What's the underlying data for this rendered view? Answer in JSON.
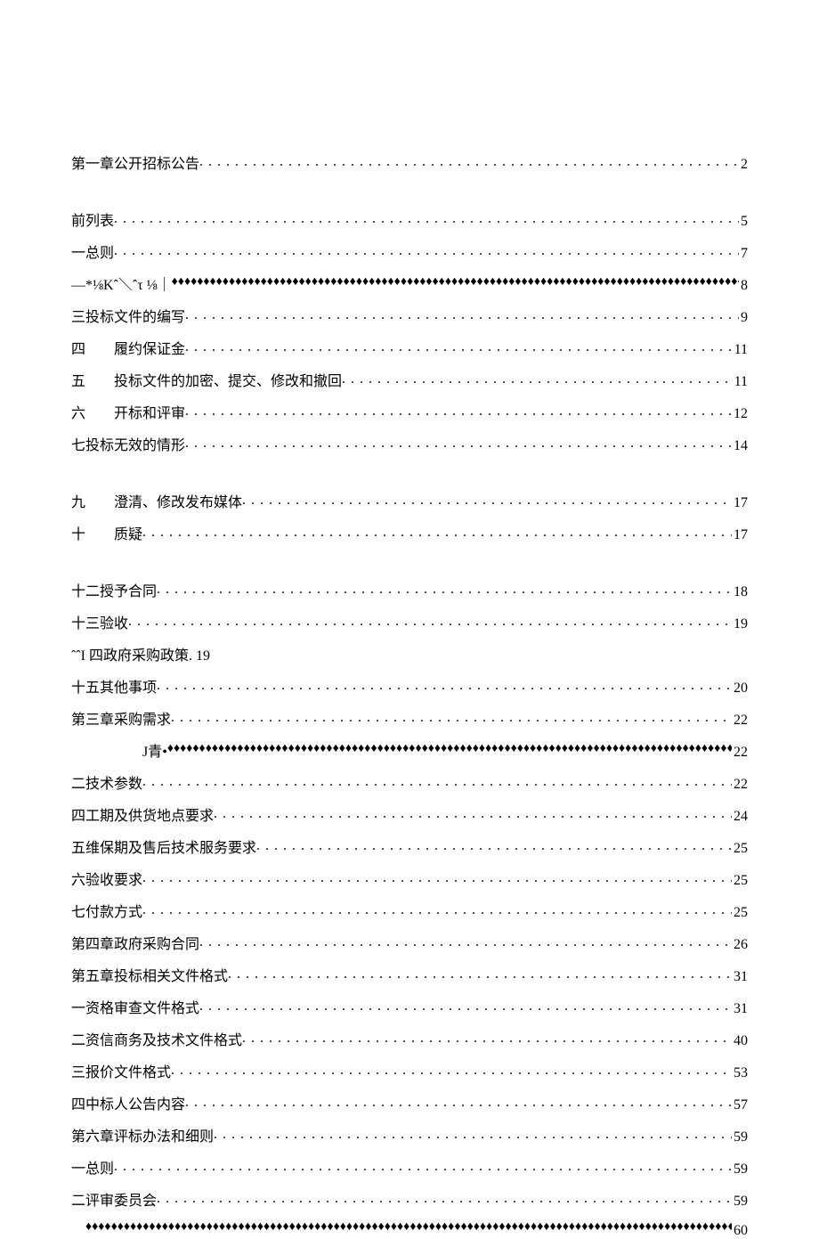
{
  "toc": [
    {
      "label": "第一章公开招标公告",
      "page": "2",
      "leader": "dots",
      "gapAfter": true
    },
    {
      "label": "前列表",
      "page": "5",
      "leader": "dots"
    },
    {
      "label": "一总则",
      "page": "7",
      "leader": "dots"
    },
    {
      "label": "—*⅛Kˆ＼ˆτ ⅛｜",
      "page": "8",
      "leader": "diamonds"
    },
    {
      "label": "三投标文件的编写",
      "page": "9",
      "leader": "dots"
    },
    {
      "label": "履约保证金 ",
      "prefix": "四",
      "page": "11",
      "leader": "dots"
    },
    {
      "label": "投标文件的加密、提交、修改和撤回 ",
      "prefix": "五",
      "page": "11",
      "leader": "dots"
    },
    {
      "label": "开标和评审 ",
      "prefix": "六",
      "page": "12",
      "leader": "dots"
    },
    {
      "label": "七投标无效的情形",
      "page": "14",
      "leader": "dots",
      "gapAfter": true
    },
    {
      "label": "澄清、修改发布媒体 ",
      "prefix": "九",
      "page": "17",
      "leader": "dots"
    },
    {
      "label": "质疑 ",
      "prefix": "十",
      "page": "17",
      "leader": "dots",
      "gapAfter": true
    },
    {
      "label": "十二授予合同",
      "page": "18",
      "leader": "dots"
    },
    {
      "label": "十三验收",
      "page": "19",
      "leader": "dots"
    },
    {
      "label": "ˆˆI 四政府采购政策. 19",
      "leader": "none"
    },
    {
      "label": "十五其他事项",
      "page": "20",
      "leader": "dots"
    },
    {
      "label": "第三章采购需求",
      "page": "22",
      "leader": "dots"
    },
    {
      "label": "J青•",
      "page": "22",
      "leader": "diamonds",
      "indentClass": "indent-jqing"
    },
    {
      "label": "二技术参数",
      "page": "22",
      "leader": "dots"
    },
    {
      "label": "四工期及供货地点要求",
      "page": "24",
      "leader": "dots"
    },
    {
      "label": "五维保期及售后技术服务要求",
      "page": "25",
      "leader": "dots"
    },
    {
      "label": "六验收要求",
      "page": "25",
      "leader": "dots"
    },
    {
      "label": "七付款方式",
      "page": "25",
      "leader": "dots"
    },
    {
      "label": "第四章政府采购合同",
      "page": "26",
      "leader": "dots"
    },
    {
      "label": "第五章投标相关文件格式",
      "page": "31",
      "leader": "dots"
    },
    {
      "label": "一资格审查文件格式",
      "page": "31",
      "leader": "dots"
    },
    {
      "label": "二资信商务及技术文件格式",
      "page": "40",
      "leader": "dots"
    },
    {
      "label": "三报价文件格式",
      "page": "53",
      "leader": "dots"
    },
    {
      "label": "四中标人公告内容",
      "page": "57",
      "leader": "dots"
    },
    {
      "label": "第六章评标办法和细则",
      "page": "59",
      "leader": "dots"
    },
    {
      "label": "一总则",
      "page": "59",
      "leader": "dots"
    },
    {
      "label": "二评审委员会",
      "page": "59",
      "leader": "dots"
    },
    {
      "label": "—",
      "page": "60",
      "leader": "diamonds",
      "indentClass": "dash-leader"
    }
  ]
}
